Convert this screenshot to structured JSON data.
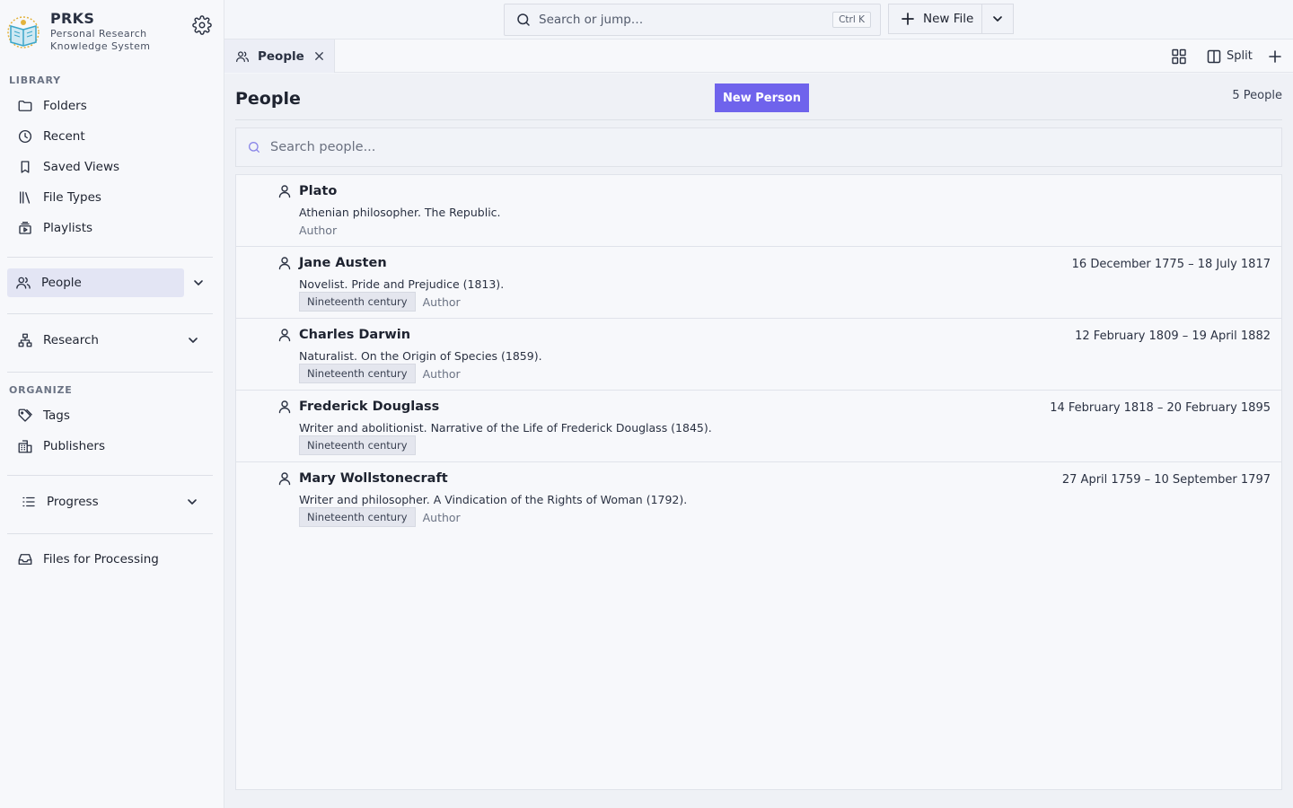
{
  "brand": {
    "name": "PRKS",
    "subtitle": "Personal Research Knowledge System"
  },
  "sidebar": {
    "library_label": "LIBRARY",
    "library_items": [
      {
        "label": "Folders",
        "icon": "folder-icon"
      },
      {
        "label": "Recent",
        "icon": "clock-icon"
      },
      {
        "label": "Saved Views",
        "icon": "bookmark-icon"
      },
      {
        "label": "File Types",
        "icon": "library-icon"
      },
      {
        "label": "Playlists",
        "icon": "playlist-icon"
      }
    ],
    "people_label": "People",
    "research_label": "Research",
    "organize_label": "ORGANIZE",
    "organize_items": [
      {
        "label": "Tags",
        "icon": "tag-icon"
      },
      {
        "label": "Publishers",
        "icon": "building-icon"
      }
    ],
    "progress_label": "Progress",
    "files_processing_label": "Files for Processing"
  },
  "topbar": {
    "search_placeholder": "Search or jump…",
    "shortcut": "Ctrl K",
    "new_file_label": "New File"
  },
  "tabs": {
    "active_label": "People",
    "split_label": "Split"
  },
  "main": {
    "title": "People",
    "new_person_label": "New Person",
    "count_label": "5 People",
    "search_placeholder": "Search people..."
  },
  "people": [
    {
      "name": "Plato",
      "dates": "",
      "description": "Athenian philosopher. The Republic.",
      "tag": "",
      "role": "Author"
    },
    {
      "name": "Jane Austen",
      "dates": "16 December 1775 – 18 July 1817",
      "description": "Novelist. Pride and Prejudice (1813).",
      "tag": "Nineteenth century",
      "role": "Author"
    },
    {
      "name": "Charles Darwin",
      "dates": "12 February 1809 – 19 April 1882",
      "description": "Naturalist. On the Origin of Species (1859).",
      "tag": "Nineteenth century",
      "role": "Author"
    },
    {
      "name": "Frederick Douglass",
      "dates": "14 February 1818 – 20 February 1895",
      "description": "Writer and abolitionist. Narrative of the Life of Frederick Douglass (1845).",
      "tag": "Nineteenth century",
      "role": ""
    },
    {
      "name": "Mary Wollstonecraft",
      "dates": "27 April 1759 – 10 September 1797",
      "description": "Writer and philosopher. A Vindication of the Rights of Woman (1792).",
      "tag": "Nineteenth century",
      "role": "Author"
    }
  ],
  "colors": {
    "accent": "#6f63ec",
    "active_nav_bg": "#e3e5f4",
    "sidebar_bg": "#f7f8fb",
    "main_bg": "#eff1f6"
  }
}
